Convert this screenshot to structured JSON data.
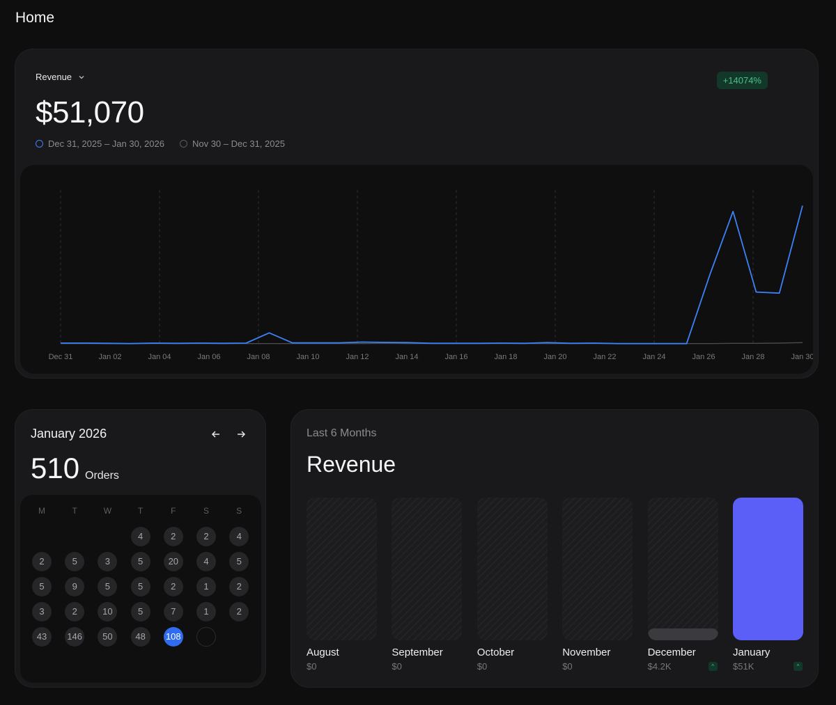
{
  "page": {
    "title": "Home"
  },
  "revenue_card": {
    "metric_label": "Revenue",
    "value": "$51,070",
    "growth": "+14074%",
    "current_range": "Dec 31, 2025 – Jan 30, 2026",
    "previous_range": "Nov 30 – Dec 31, 2025"
  },
  "colors": {
    "current": "#3b82f6",
    "previous": "#4a4a4f",
    "accent_bar": "#5b5ef7",
    "today": "#2f6cf0"
  },
  "chart_data": {
    "type": "line",
    "x_ticks": [
      "Dec 31",
      "Jan 02",
      "Jan 04",
      "Jan 06",
      "Jan 08",
      "Jan 10",
      "Jan 12",
      "Jan 14",
      "Jan 16",
      "Jan 18",
      "Jan 20",
      "Jan 22",
      "Jan 24",
      "Jan 26",
      "Jan 28",
      "Jan 30"
    ],
    "grid": "vertical dashed",
    "series": [
      {
        "name": "Dec 31, 2025 – Jan 30, 2026",
        "values": [
          60,
          60,
          40,
          20,
          60,
          40,
          60,
          40,
          60,
          950,
          80,
          80,
          80,
          150,
          120,
          100,
          40,
          40,
          40,
          60,
          40,
          100,
          40,
          60,
          20,
          20,
          20,
          20,
          6000,
          11500,
          4500,
          4400,
          12000
        ]
      },
      {
        "name": "Nov 30 – Dec 31, 2025",
        "values": [
          20,
          20,
          20,
          20,
          20,
          20,
          20,
          20,
          20,
          20,
          20,
          20,
          20,
          20,
          40,
          20,
          20,
          20,
          20,
          20,
          20,
          20,
          20,
          20,
          20,
          20,
          20,
          20,
          20,
          40,
          40,
          60,
          100
        ]
      }
    ]
  },
  "calendar": {
    "month": "January 2026",
    "orders_count": "510",
    "orders_label": "Orders",
    "prev_icon": "arrow-left-icon",
    "next_icon": "arrow-right-icon",
    "weekdays": [
      "M",
      "T",
      "W",
      "T",
      "F",
      "S",
      "S"
    ],
    "days": [
      [
        "",
        "",
        "",
        "4",
        "2",
        "2",
        "4"
      ],
      [
        "2",
        "5",
        "3",
        "5",
        "20",
        "4",
        "5"
      ],
      [
        "5",
        "9",
        "5",
        "5",
        "2",
        "1",
        "2"
      ],
      [
        "3",
        "2",
        "10",
        "5",
        "7",
        "1",
        "2"
      ],
      [
        "43",
        "146",
        "50",
        "48",
        "108",
        "",
        ""
      ]
    ],
    "today_value": "108"
  },
  "months_card": {
    "subtitle": "Last 6 Months",
    "title": "Revenue",
    "months": [
      {
        "name": "August",
        "amount": "$0",
        "level": 0,
        "badge": false
      },
      {
        "name": "September",
        "amount": "$0",
        "level": 0,
        "badge": false
      },
      {
        "name": "October",
        "amount": "$0",
        "level": 0,
        "badge": false
      },
      {
        "name": "November",
        "amount": "$0",
        "level": 0,
        "badge": false
      },
      {
        "name": "December",
        "amount": "$4.2K",
        "level": 0.082,
        "badge": true
      },
      {
        "name": "January",
        "amount": "$51K",
        "level": 1.0,
        "badge": true
      }
    ]
  }
}
